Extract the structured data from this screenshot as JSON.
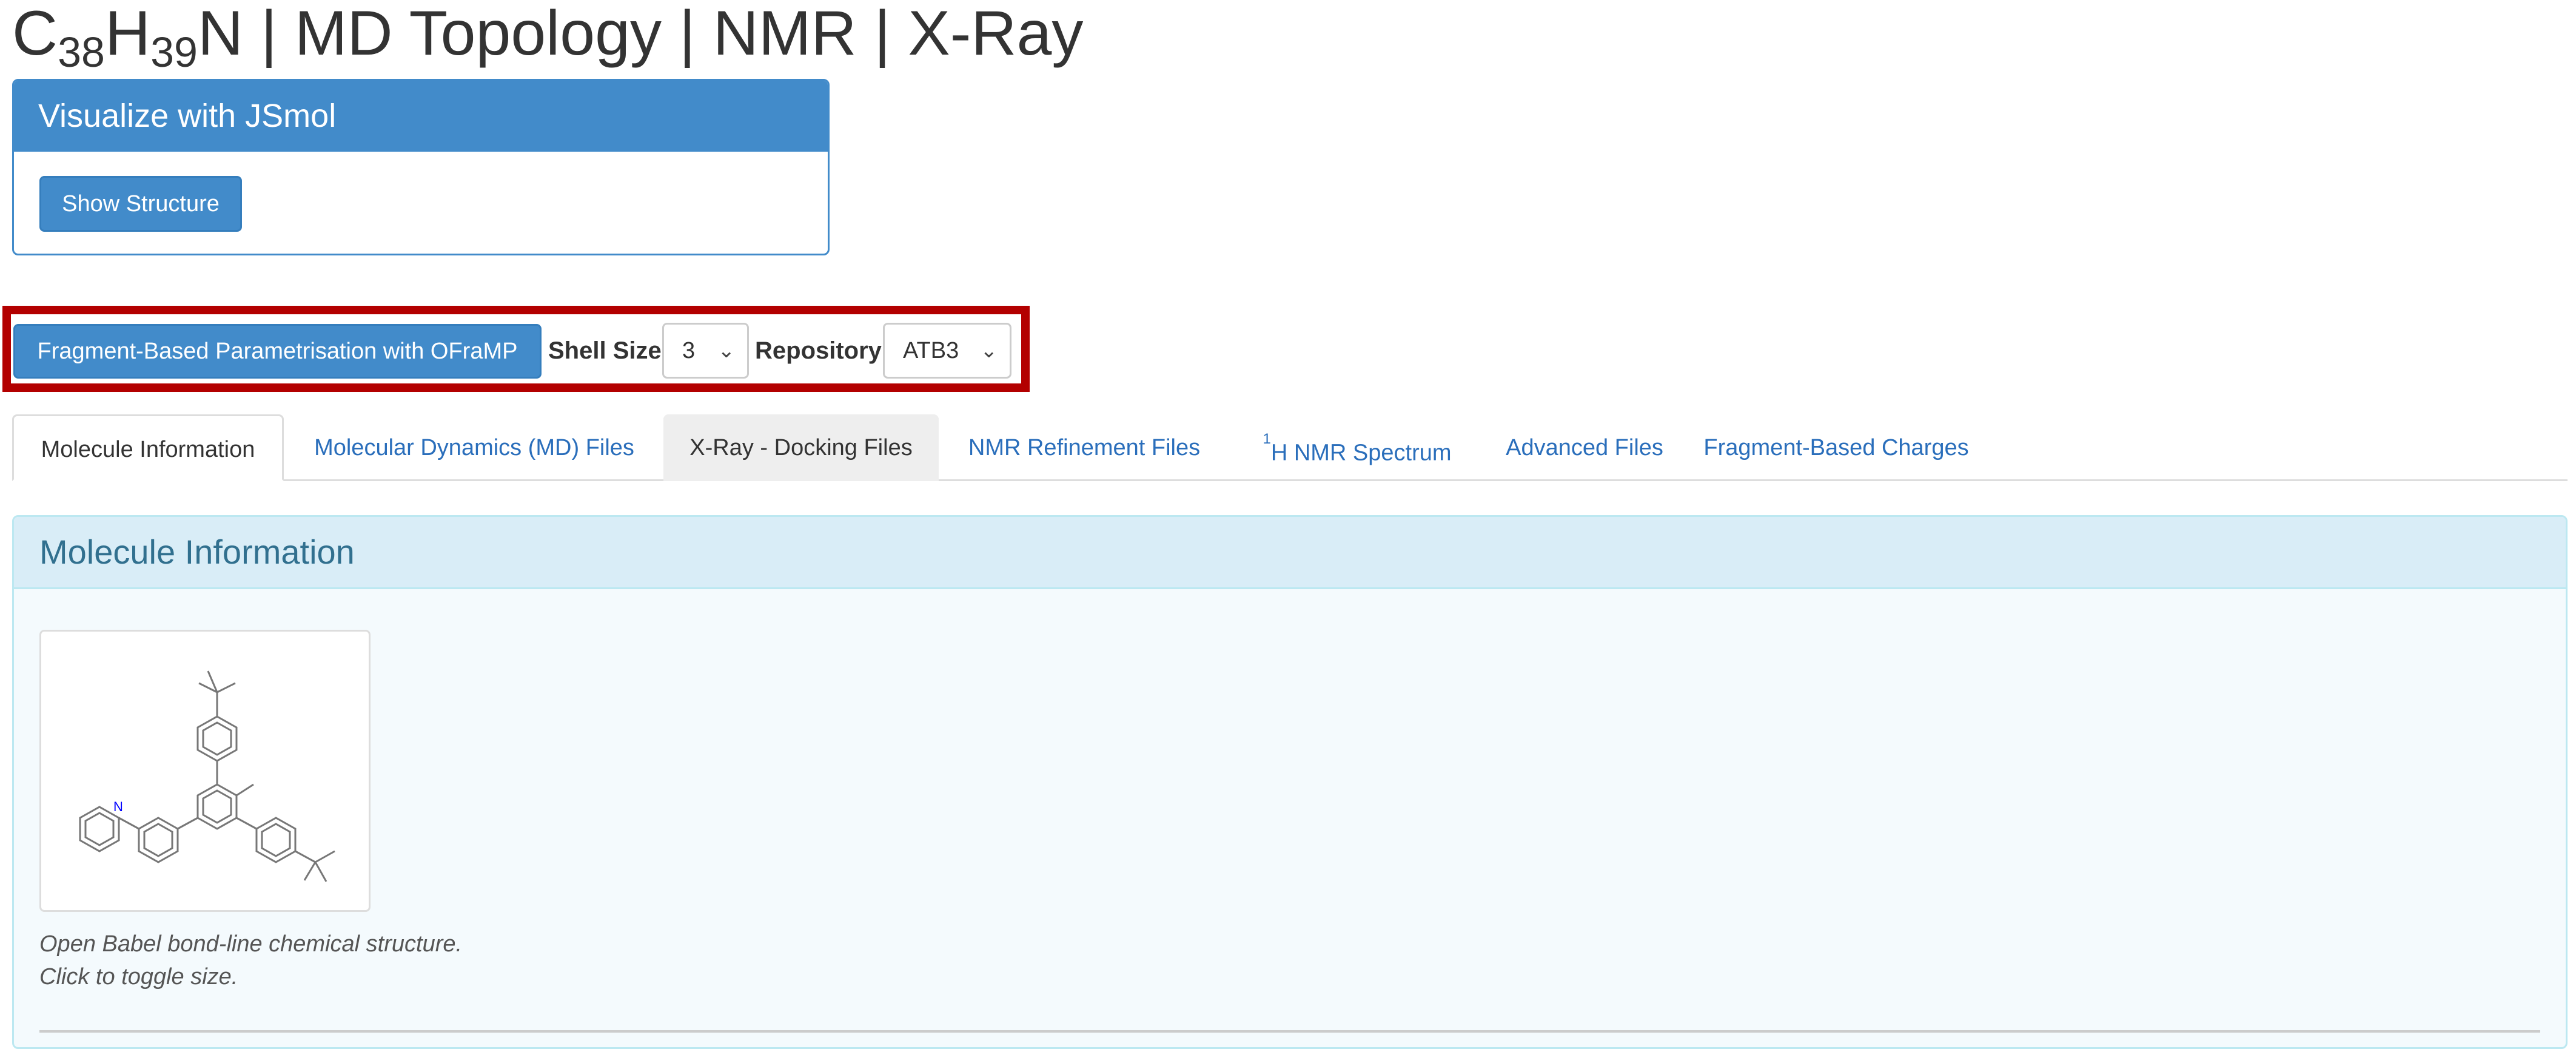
{
  "page": {
    "title_c": "C",
    "title_c_count": "38",
    "title_h": "H",
    "title_h_count": "39",
    "title_rest": "N | MD Topology | NMR | X-Ray"
  },
  "jsmol": {
    "heading": "Visualize with JSmol",
    "show_structure": "Show Structure"
  },
  "oframp": {
    "button": "Fragment-Based Parametrisation with OFraMP",
    "shell_size_label": "Shell Size",
    "shell_size_value": "3",
    "repository_label": "Repository",
    "repository_value": "ATB3"
  },
  "tabs": [
    {
      "label": "Molecule Information",
      "state": "active"
    },
    {
      "label": "Molecular Dynamics (MD) Files",
      "state": "link"
    },
    {
      "label": "X-Ray - Docking Files",
      "state": "hover"
    },
    {
      "label": "NMR Refinement Files",
      "state": "link"
    },
    {
      "label_sup": "1",
      "label": "H NMR Spectrum",
      "state": "link"
    },
    {
      "label": "Advanced Files",
      "state": "link"
    },
    {
      "label": "Fragment-Based Charges",
      "state": "link"
    }
  ],
  "info": {
    "heading": "Molecule Information",
    "nitrogen_atom": "N",
    "caption_line1": "Open Babel bond-line chemical structure.",
    "caption_line2": "Click to toggle size."
  },
  "colors": {
    "primary": "#428bca",
    "link": "#2a6ebb",
    "highlight_box": "#b30000",
    "info_heading_bg": "#d9edf7",
    "info_heading_text": "#31708f",
    "nitrogen": "#0000ff"
  },
  "icons": {
    "select_arrow": "chevron-down-icon"
  }
}
